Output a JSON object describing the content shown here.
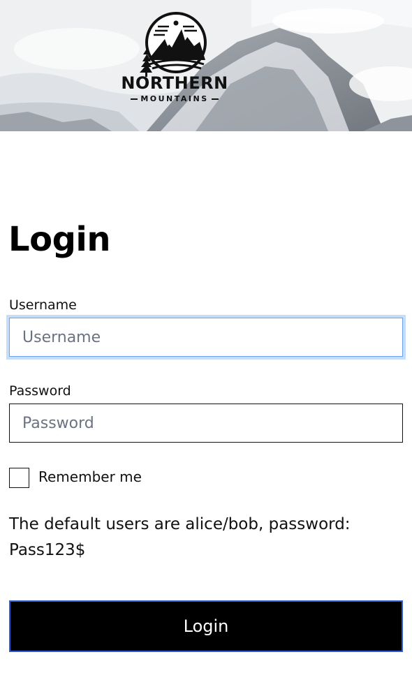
{
  "brand": {
    "title": "NORTHERN",
    "subtitle": "MOUNTAINS"
  },
  "page_title": "Login",
  "username": {
    "label": "Username",
    "placeholder": "Username",
    "value": ""
  },
  "password": {
    "label": "Password",
    "placeholder": "Password",
    "value": ""
  },
  "remember": {
    "label": "Remember me",
    "checked": false
  },
  "hint": "The default users are alice/bob, password: Pass123$",
  "submit_label": "Login",
  "icons": {
    "logo": "mountain-logo-icon"
  },
  "colors": {
    "button_bg": "#000000",
    "button_border": "#2f5bd3",
    "focus_ring": "#c6dcfb"
  }
}
